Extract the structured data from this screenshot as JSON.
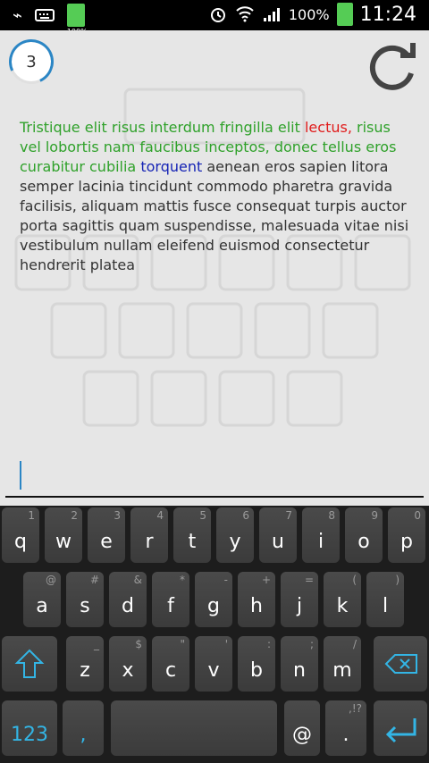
{
  "status": {
    "battery_small_text": "100%",
    "battery_text": "100%",
    "time": "11:24"
  },
  "app": {
    "counter": "3"
  },
  "passage": {
    "typed": "Tristique elit risus interdum fringilla elit ",
    "error": "lectus,",
    "typed2": " risus vel lobortis nam faucibus inceptos, donec tellus eros curabitur cubilia ",
    "current": "torquent",
    "remaining": " aenean eros sapien litora semper lacinia tincidunt commodo pharetra gravida facilisis, aliquam mattis fusce consequat turpis auctor porta sagittis quam suspendisse, malesuada vitae nisi vestibulum nullam eleifend euismod consectetur hendrerit platea"
  },
  "keyboard": {
    "row1": [
      {
        "main": "q",
        "alt": "1"
      },
      {
        "main": "w",
        "alt": "2"
      },
      {
        "main": "e",
        "alt": "3"
      },
      {
        "main": "r",
        "alt": "4"
      },
      {
        "main": "t",
        "alt": "5"
      },
      {
        "main": "y",
        "alt": "6"
      },
      {
        "main": "u",
        "alt": "7"
      },
      {
        "main": "i",
        "alt": "8"
      },
      {
        "main": "o",
        "alt": "9"
      },
      {
        "main": "p",
        "alt": "0"
      }
    ],
    "row2": [
      {
        "main": "a",
        "alt": "@"
      },
      {
        "main": "s",
        "alt": "#"
      },
      {
        "main": "d",
        "alt": "&"
      },
      {
        "main": "f",
        "alt": "*"
      },
      {
        "main": "g",
        "alt": "-"
      },
      {
        "main": "h",
        "alt": "+"
      },
      {
        "main": "j",
        "alt": "="
      },
      {
        "main": "k",
        "alt": "("
      },
      {
        "main": "l",
        "alt": ")"
      }
    ],
    "row3": [
      {
        "main": "z",
        "alt": "_"
      },
      {
        "main": "x",
        "alt": "$"
      },
      {
        "main": "c",
        "alt": "\""
      },
      {
        "main": "v",
        "alt": "'"
      },
      {
        "main": "b",
        "alt": ":"
      },
      {
        "main": "n",
        "alt": ";"
      },
      {
        "main": "m",
        "alt": "/"
      }
    ],
    "row4": {
      "numbers": "123",
      "comma": ",",
      "at": "@",
      "period": ".",
      "period_alt": ",!?",
      "enter_icon": "enter-icon"
    }
  }
}
